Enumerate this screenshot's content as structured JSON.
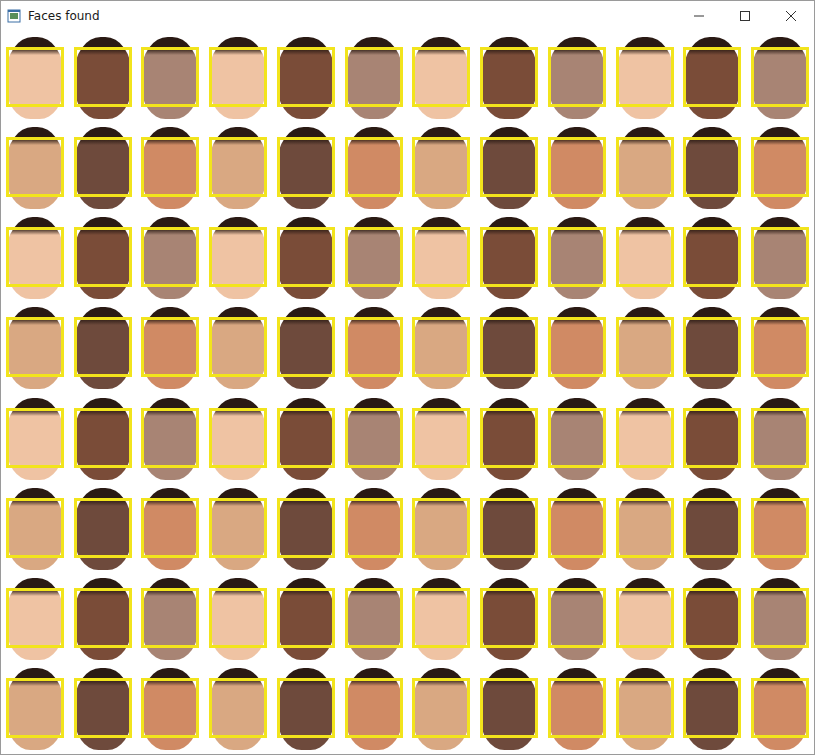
{
  "window": {
    "title": "Faces found"
  },
  "grid": {
    "rows": [
      {
        "cells": [
          {
            "detected": true
          },
          {
            "detected": true
          },
          {
            "detected": true
          },
          {
            "detected": true
          },
          {
            "detected": true
          },
          {
            "detected": true
          },
          {
            "detected": true
          },
          {
            "detected": true
          },
          {
            "detected": true
          },
          {
            "detected": true
          },
          {
            "detected": true
          },
          {
            "detected": true
          }
        ]
      },
      {
        "cells": [
          {
            "detected": true
          },
          {
            "detected": true
          },
          {
            "detected": true
          },
          {
            "detected": true
          },
          {
            "detected": true
          },
          {
            "detected": true
          },
          {
            "detected": true
          },
          {
            "detected": true
          },
          {
            "detected": true
          },
          {
            "detected": true
          },
          {
            "detected": true
          },
          {
            "detected": true
          }
        ]
      },
      {
        "cells": [
          {
            "detected": true
          },
          {
            "detected": true
          },
          {
            "detected": true
          },
          {
            "detected": true
          },
          {
            "detected": true
          },
          {
            "detected": true
          },
          {
            "detected": true
          },
          {
            "detected": true
          },
          {
            "detected": true
          },
          {
            "detected": true
          },
          {
            "detected": true
          },
          {
            "detected": true
          }
        ]
      },
      {
        "cells": [
          {
            "detected": true
          },
          {
            "detected": true
          },
          {
            "detected": true
          },
          {
            "detected": true
          },
          {
            "detected": true
          },
          {
            "detected": true
          },
          {
            "detected": true
          },
          {
            "detected": true
          },
          {
            "detected": true
          },
          {
            "detected": true
          },
          {
            "detected": true
          },
          {
            "detected": true
          }
        ]
      },
      {
        "cells": [
          {
            "detected": true
          },
          {
            "detected": true
          },
          {
            "detected": true
          },
          {
            "detected": true
          },
          {
            "detected": true
          },
          {
            "detected": true
          },
          {
            "detected": true
          },
          {
            "detected": true
          },
          {
            "detected": true
          },
          {
            "detected": true
          },
          {
            "detected": true
          },
          {
            "detected": true
          }
        ]
      },
      {
        "cells": [
          {
            "detected": true
          },
          {
            "detected": true
          },
          {
            "detected": true
          },
          {
            "detected": true
          },
          {
            "detected": true
          },
          {
            "detected": true
          },
          {
            "detected": true
          },
          {
            "detected": true
          },
          {
            "detected": true
          },
          {
            "detected": true
          },
          {
            "detected": true
          },
          {
            "detected": true
          }
        ]
      },
      {
        "cells": [
          {
            "detected": true
          },
          {
            "detected": true
          },
          {
            "detected": true
          },
          {
            "detected": true
          },
          {
            "detected": true
          },
          {
            "detected": true
          },
          {
            "detected": true
          },
          {
            "detected": true
          },
          {
            "detected": true
          },
          {
            "detected": true
          },
          {
            "detected": true
          },
          {
            "detected": true
          }
        ]
      },
      {
        "cells": [
          {
            "detected": true
          },
          {
            "detected": true
          },
          {
            "detected": true
          },
          {
            "detected": true
          },
          {
            "detected": true
          },
          {
            "detected": true
          },
          {
            "detected": true
          },
          {
            "detected": true
          },
          {
            "detected": true
          },
          {
            "detected": true
          },
          {
            "detected": true
          },
          {
            "detected": true
          }
        ]
      }
    ]
  }
}
